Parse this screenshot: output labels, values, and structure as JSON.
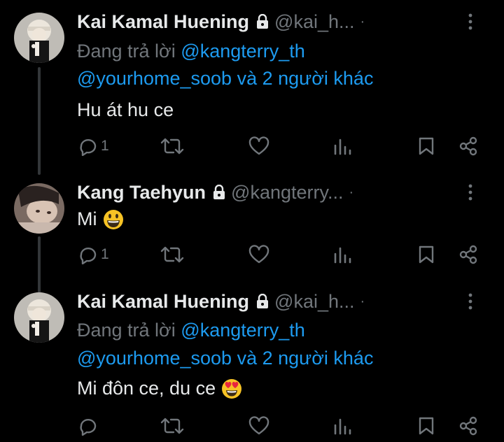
{
  "tweets": [
    {
      "name": "Kai Kamal Huening",
      "handle": "@kai_h...",
      "separator": "·",
      "reply_prefix": "Đang trả lời",
      "reply_user": "@kangterry_th",
      "reply_line2_user": "@yourhome_soob",
      "reply_line2_rest": "và 2 người khác",
      "text": "Hu át hu ce",
      "emoji": "",
      "reply_count": "1",
      "views_count": ""
    },
    {
      "name": "Kang Taehyun",
      "handle": "@kangterry...",
      "separator": "·",
      "text": "Mi",
      "emoji": "grinning-face",
      "reply_count": "1"
    },
    {
      "name": "Kai Kamal Huening",
      "handle": "@kai_h...",
      "separator": "·",
      "reply_prefix": "Đang trả lời",
      "reply_user": "@kangterry_th",
      "reply_line2_user": "@yourhome_soob",
      "reply_line2_rest": "và 2 người khác",
      "text": "Mi đôn ce, du ce",
      "emoji": "heart-eyes-face",
      "reply_count": ""
    }
  ],
  "colors": {
    "background": "#000000",
    "text": "#e7e9ea",
    "muted": "#71767b",
    "link": "#1d9bf0",
    "thread_line": "#333639"
  },
  "icons": [
    "lock-icon",
    "more-icon",
    "reply-icon",
    "retweet-icon",
    "like-icon",
    "views-icon",
    "bookmark-icon",
    "share-icon"
  ]
}
